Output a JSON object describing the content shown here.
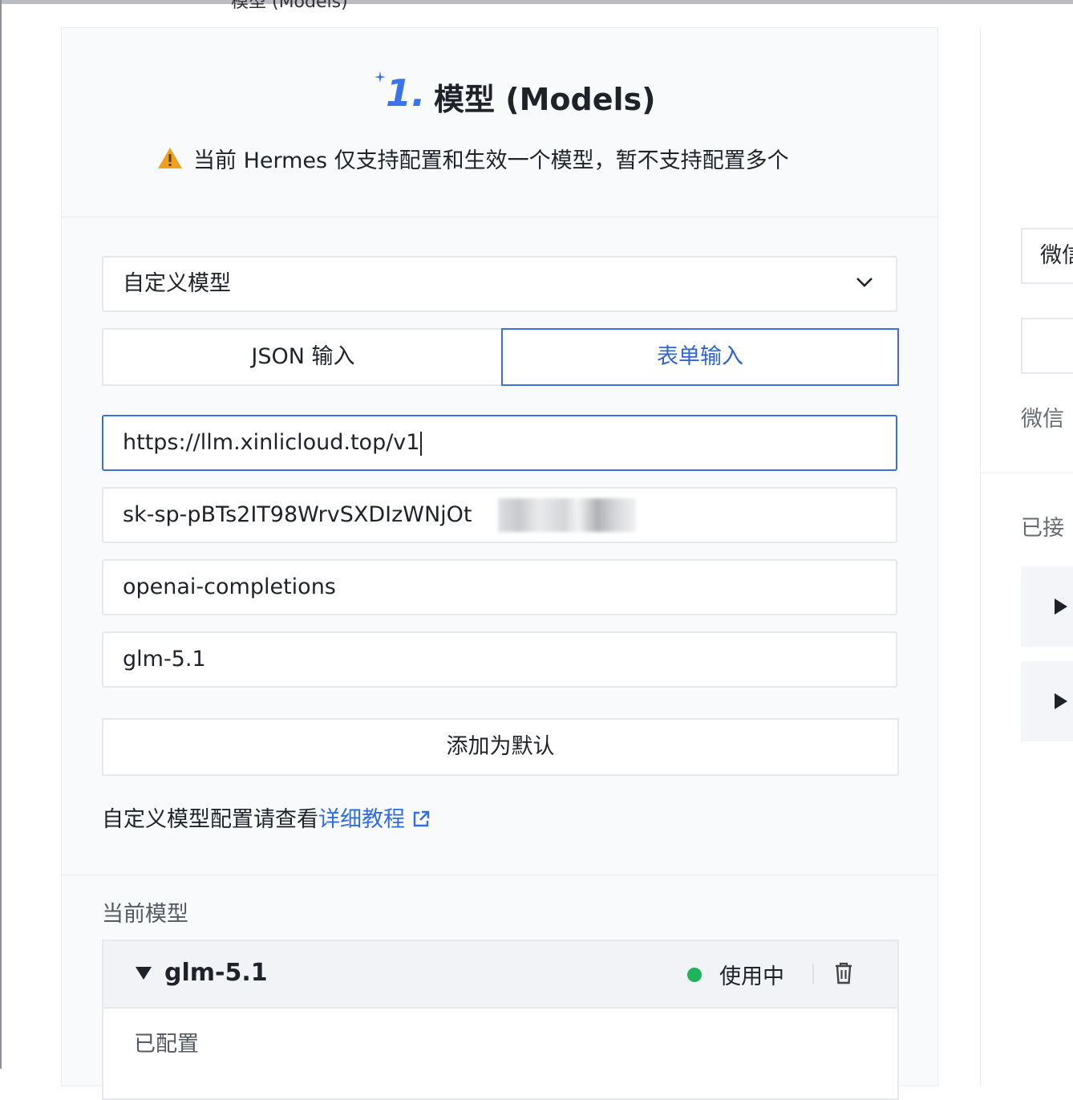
{
  "header_partial": "模型 (Models)",
  "section": {
    "number": "1.",
    "title": "模型 (Models)",
    "warning": "当前 Hermes 仅支持配置和生效一个模型，暂不支持配置多个"
  },
  "form": {
    "model_select": "自定义模型",
    "tabs": [
      {
        "label": "JSON 输入",
        "active": false
      },
      {
        "label": "表单输入",
        "active": true
      }
    ],
    "base_url": "https://llm.xinlicloud.top/v1",
    "api_key": "sk-sp-pBTs2IT98WrvSXDIzWNjOt",
    "api_type": "openai-completions",
    "model_id": "glm-5.1",
    "add_default_button": "添加为默认",
    "help_prefix": "自定义模型配置请查看",
    "help_link": "详细教程"
  },
  "current": {
    "label": "当前模型",
    "model_name": "glm-5.1",
    "status": "使用中",
    "configured_label": "已配置"
  },
  "right_panel": {
    "input_partial": "微信",
    "label1": "微信",
    "label2": "已接"
  },
  "colors": {
    "accent": "#3b6fe0",
    "link": "#2f6de0",
    "status_green": "#1fb45a",
    "warning": "#f0a020"
  }
}
